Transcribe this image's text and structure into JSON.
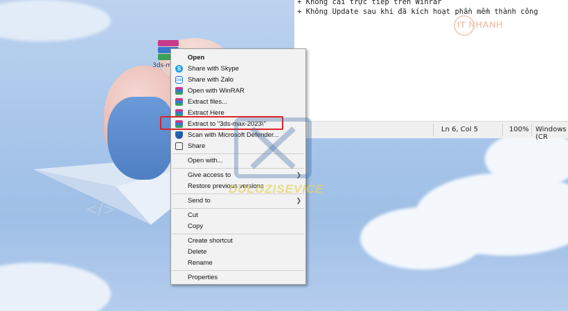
{
  "desktop": {
    "icon_label": "3ds-max..."
  },
  "notepad": {
    "lines": [
      "+ Không cài trực tiếp trên Winrar",
      "+ Không Update sau khi đã kích hoạt phần mềm thành công"
    ],
    "watermark": "IT NHANH",
    "status": {
      "position": "Ln 6, Col 5",
      "zoom": "100%",
      "encoding": "Windows (CR"
    }
  },
  "context_menu": {
    "open": "Open",
    "share_skype": "Share with Skype",
    "share_zalo": "Share with Zalo",
    "open_winrar": "Open with WinRAR",
    "extract_files": "Extract files...",
    "extract_here": "Extract Here",
    "extract_to": "Extract to \"3ds-max-2023\\\"",
    "scan_defender": "Scan with Microsoft Defender...",
    "share": "Share",
    "open_with": "Open with...",
    "give_access": "Give access to",
    "restore_versions": "Restore previous versions",
    "send_to": "Send to",
    "cut": "Cut",
    "copy": "Copy",
    "create_shortcut": "Create shortcut",
    "delete": "Delete",
    "rename": "Rename",
    "properties": "Properties",
    "zalo_icon_text": "Zalo",
    "skype_icon_text": "S"
  },
  "overlay_watermark": "DULOZISEVICE",
  "colors": {
    "highlight": "#d9232a",
    "menu_bg": "#f2f2f2"
  }
}
